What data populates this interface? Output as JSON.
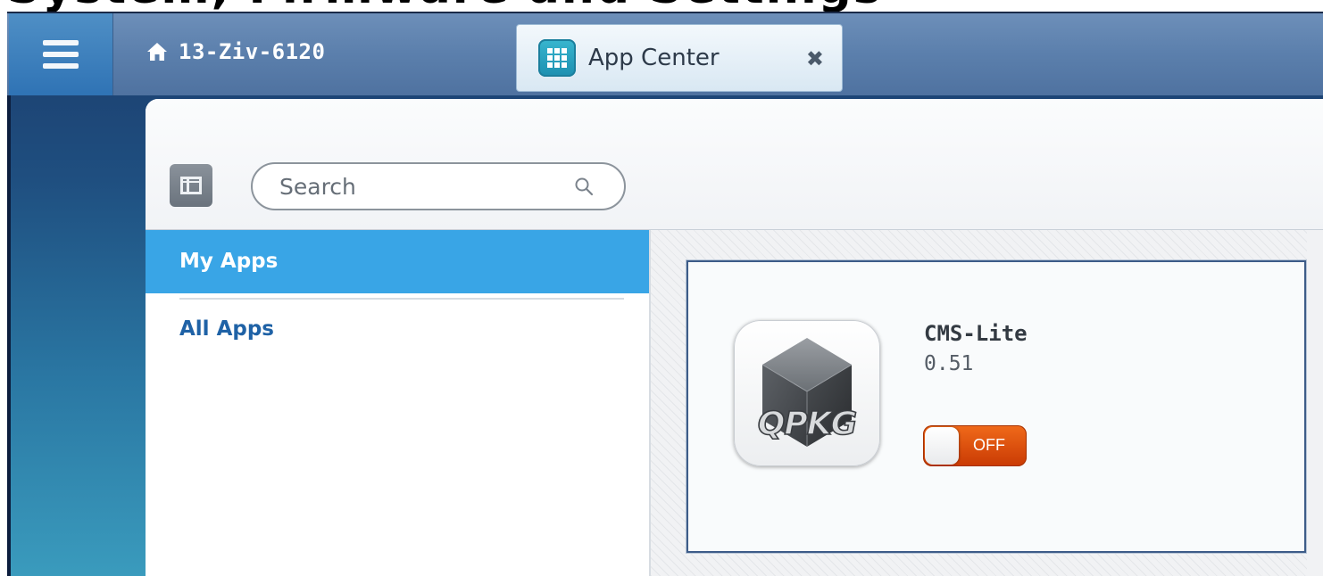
{
  "page_heading_cropped": "System, Firmware and Settings",
  "taskbar": {
    "menu_icon": "hamburger-icon",
    "home_icon": "home-icon",
    "home_label": "13-Ziv-6120",
    "tab": {
      "icon": "app-center-grid-icon",
      "label": "App Center",
      "close_glyph": "✖"
    }
  },
  "toolbar": {
    "sidebar_toggle_icon": "sidebar-toggle-icon",
    "search": {
      "placeholder": "Search",
      "value": "",
      "icon": "search-icon"
    }
  },
  "sidebar": {
    "items": [
      {
        "label": "My Apps",
        "active": true
      },
      {
        "label": "All Apps",
        "active": false
      }
    ]
  },
  "app_card": {
    "logo_icon": "qpkg-cube-icon",
    "logo_text": "QPKG",
    "name": "CMS-Lite",
    "version": "0.51",
    "toggle": {
      "state": "off",
      "label": "OFF"
    }
  },
  "colors": {
    "accent_blue": "#39a5e6",
    "link_blue": "#1f62a6",
    "toggle_off_orange": "#e0520e",
    "taskbar": "#5b7fac"
  }
}
